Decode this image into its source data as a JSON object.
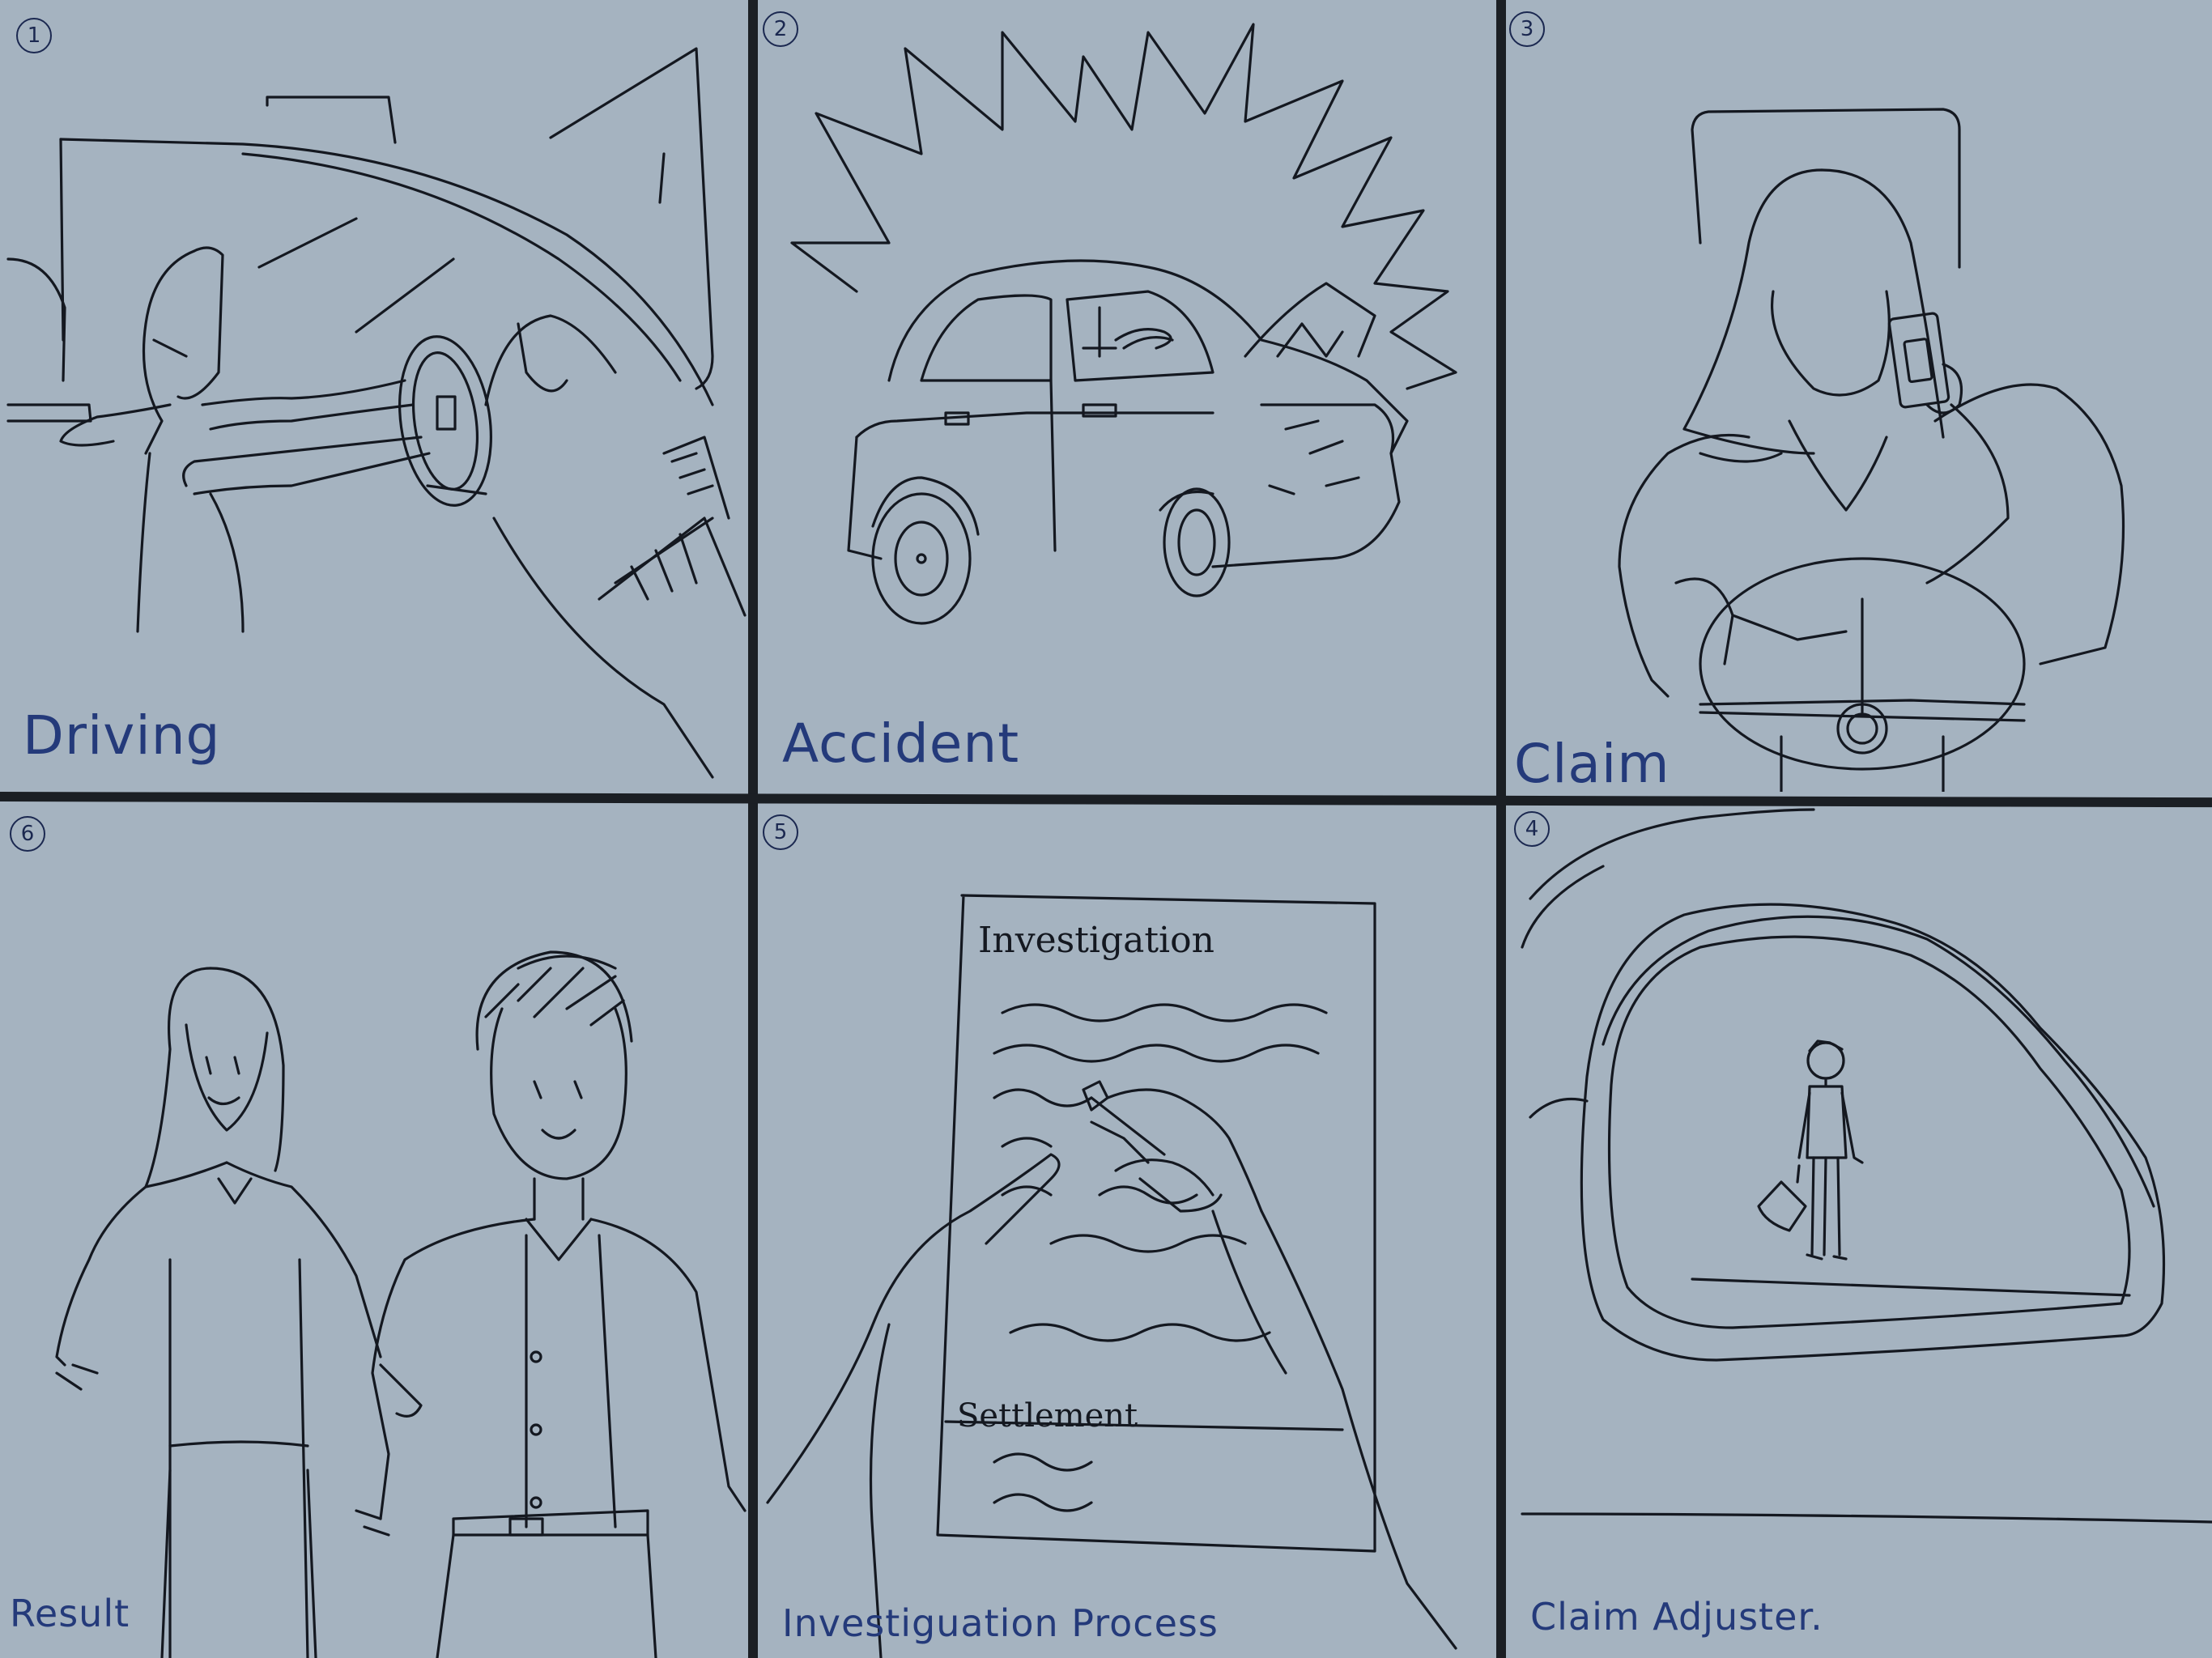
{
  "panels": [
    {
      "number": "1",
      "caption": "Driving"
    },
    {
      "number": "2",
      "caption": "Accident"
    },
    {
      "number": "3",
      "caption": "Claim"
    },
    {
      "number": "6",
      "caption": "Result"
    },
    {
      "number": "5",
      "caption": "Investiguation Process"
    },
    {
      "number": "4",
      "caption": "Claim Adjuster."
    }
  ],
  "document": {
    "heading": "Investigation",
    "section": "Settlement"
  },
  "colors": {
    "background": "#a5b3c0",
    "ink": "#141820",
    "caption": "#243a7a",
    "divider": "#1b1f24"
  }
}
